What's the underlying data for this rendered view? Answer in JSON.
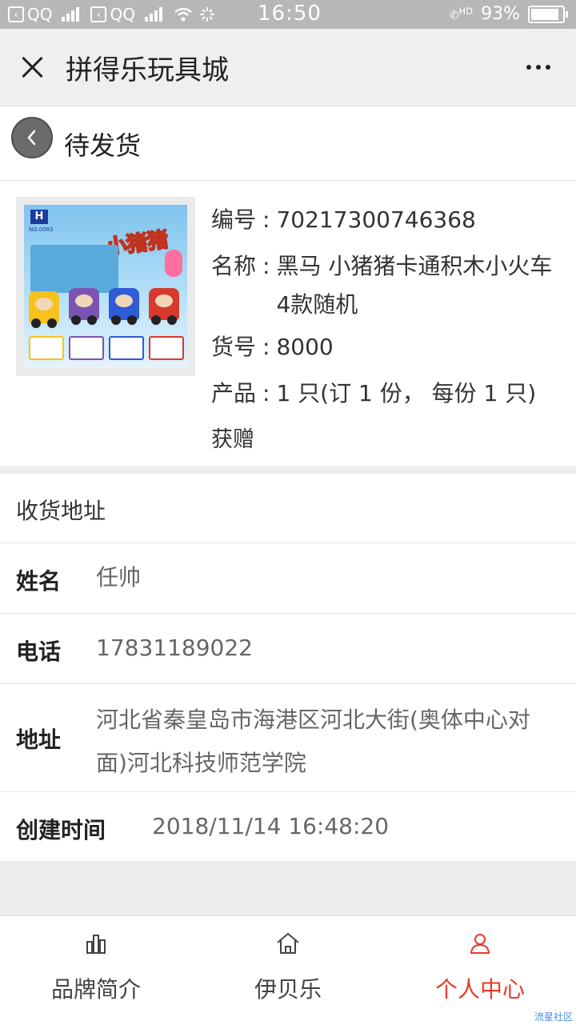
{
  "status_bar": {
    "qq1": "QQ",
    "qq2": "QQ",
    "time": "16:50",
    "hd": "HD",
    "battery": "93%"
  },
  "title_bar": {
    "title": "拼得乐玩具城"
  },
  "page_header": {
    "title": "待发货"
  },
  "product": {
    "image": {
      "logo": "H",
      "brand_text": "小猪猪",
      "sub_text": "NO.0083"
    },
    "code_label": "编号",
    "code_value": "70217300746368",
    "name_label": "名称",
    "name_value": "黑马 小猪猪卡通积木小火车4款随机",
    "sku_label": "货号",
    "sku_value": "8000",
    "qty_label": "产品",
    "qty_value": "1 只(订 1 份， 每份 1 只)",
    "gift": "获赠"
  },
  "address": {
    "section_title": "收货地址",
    "name_label": "姓名",
    "name_value": "任帅",
    "phone_label": "电话",
    "phone_value": "17831189022",
    "addr_label": "地址",
    "addr_value": "河北省秦皇岛市海港区河北大街(奥体中心对面)河北科技师范学院",
    "created_label": "创建时间",
    "created_value": "2018/11/14 16:48:20"
  },
  "bottom_nav": {
    "items": [
      {
        "label": "品牌简介",
        "icon": "bar-chart-icon",
        "active": false
      },
      {
        "label": "伊贝乐",
        "icon": "home-icon",
        "active": false
      },
      {
        "label": "个人中心",
        "icon": "user-icon",
        "active": true
      }
    ],
    "active_color": "#e83a2a"
  },
  "watermark": "流星社区"
}
